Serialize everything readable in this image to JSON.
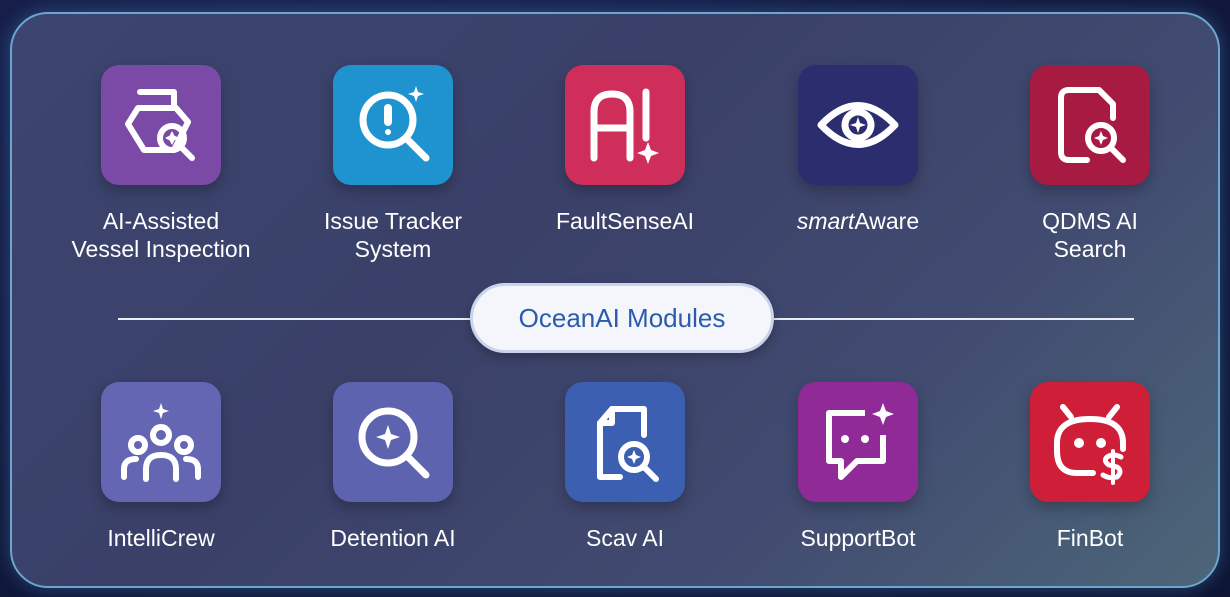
{
  "section_title": "OceanAI Modules",
  "colors": {
    "vessel": "#7b4aa6",
    "issue": "#1e93cf",
    "fault": "#cf2e5a",
    "smart": "#2b2d6e",
    "qdms": "#a71b42",
    "intellicrew": "#6466b3",
    "detention": "#5e63b0",
    "scav": "#3d5fb2",
    "supportbot": "#8f2a97",
    "finbot": "#cf1f38"
  },
  "top_modules": [
    {
      "line1": "AI-Assisted",
      "line2": "Vessel Inspection",
      "icon": "vessel-search-icon"
    },
    {
      "line1": "Issue Tracker",
      "line2": "System",
      "icon": "issue-search-icon"
    },
    {
      "line1": "FaultSenseAI",
      "line2": "",
      "icon": "ai-alert-icon"
    },
    {
      "line1_italic": "smart",
      "line1_rest": "Aware",
      "icon": "eye-icon"
    },
    {
      "line1": "QDMS AI",
      "line2": "Search",
      "icon": "document-search-icon"
    }
  ],
  "bottom_modules": [
    {
      "label": "IntelliCrew",
      "icon": "crew-group-icon"
    },
    {
      "label": "Detention AI",
      "icon": "magnifier-sparkle-icon"
    },
    {
      "label": "Scav AI",
      "icon": "document-magnifier-icon"
    },
    {
      "label": "SupportBot",
      "icon": "chat-bubble-icon"
    },
    {
      "label": "FinBot",
      "icon": "bot-dollar-icon"
    }
  ]
}
